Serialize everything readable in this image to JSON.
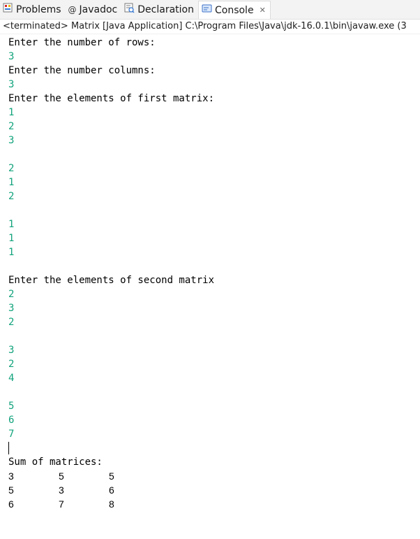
{
  "tabs": [
    {
      "label": "Problems",
      "icon": "problems-icon"
    },
    {
      "label": "Javadoc",
      "icon": "at-icon"
    },
    {
      "label": "Declaration",
      "icon": "declaration-icon"
    },
    {
      "label": "Console",
      "icon": "console-icon",
      "active": true
    }
  ],
  "console_status": "<terminated> Matrix [Java Application] C:\\Program Files\\Java\\jdk-16.0.1\\bin\\javaw.exe  (3",
  "console": {
    "lines": [
      {
        "text": "Enter the number of rows:",
        "kind": "out"
      },
      {
        "text": "3",
        "kind": "in"
      },
      {
        "text": "Enter the number columns:",
        "kind": "out"
      },
      {
        "text": "3",
        "kind": "in"
      },
      {
        "text": "Enter the elements of first matrix:",
        "kind": "out"
      },
      {
        "text": "1",
        "kind": "in"
      },
      {
        "text": "2",
        "kind": "in"
      },
      {
        "text": "3",
        "kind": "in"
      },
      {
        "text": "",
        "kind": "in"
      },
      {
        "text": "2",
        "kind": "in"
      },
      {
        "text": "1",
        "kind": "in"
      },
      {
        "text": "2",
        "kind": "in"
      },
      {
        "text": "",
        "kind": "in"
      },
      {
        "text": "1",
        "kind": "in"
      },
      {
        "text": "1",
        "kind": "in"
      },
      {
        "text": "1",
        "kind": "in"
      },
      {
        "text": "",
        "kind": "in"
      },
      {
        "text": "Enter the elements of second matrix",
        "kind": "out"
      },
      {
        "text": "2",
        "kind": "in"
      },
      {
        "text": "3",
        "kind": "in"
      },
      {
        "text": "2",
        "kind": "in"
      },
      {
        "text": "",
        "kind": "in"
      },
      {
        "text": "3",
        "kind": "in"
      },
      {
        "text": "2",
        "kind": "in"
      },
      {
        "text": "4",
        "kind": "in"
      },
      {
        "text": "",
        "kind": "in"
      },
      {
        "text": "5",
        "kind": "in"
      },
      {
        "text": "6",
        "kind": "in"
      },
      {
        "text": "7",
        "kind": "in"
      }
    ],
    "sum_label": "Sum of matrices:",
    "sum_rows": [
      [
        "3",
        "5",
        "5"
      ],
      [
        "5",
        "3",
        "6"
      ],
      [
        "6",
        "7",
        "8"
      ]
    ]
  },
  "colors": {
    "output_text": "#000000",
    "input_text": "#12a37c"
  }
}
